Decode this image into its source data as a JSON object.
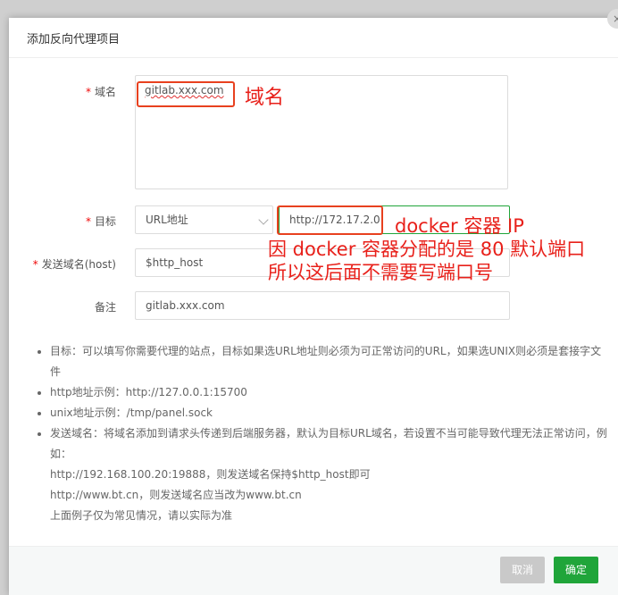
{
  "dialog": {
    "title": "添加反向代理项目",
    "close_symbol": "×"
  },
  "form": {
    "domain_label": "域名",
    "domain_value": "gitlab.xxx.com",
    "target_label": "目标",
    "target_type": "URL地址",
    "target_url": "http://172.17.2.0",
    "host_label": "发送域名(host)",
    "host_value": "$http_host",
    "remark_label": "备注",
    "remark_value": "gitlab.xxx.com",
    "required_mark": "*"
  },
  "notes": {
    "item1": "目标：可以填写你需要代理的站点，目标如果选URL地址则必须为可正常访问的URL，如果选UNIX则必须是套接字文件",
    "item2": "http地址示例：http://127.0.0.1:15700",
    "item3": "unix地址示例：/tmp/panel.sock",
    "item4": "发送域名：将域名添加到请求头传递到后端服务器，默认为目标URL域名，若设置不当可能导致代理无法正常访问，例如：",
    "item4_line2": "http://192.168.100.20:19888，则发送域名保持$http_host即可",
    "item4_line3": "http://www.bt.cn，则发送域名应当改为www.bt.cn",
    "item4_line4": "上面例子仅为常见情况，请以实际为准"
  },
  "footer": {
    "cancel_label": "取消",
    "confirm_label": "确定"
  },
  "annotations": {
    "domain_note": "域名",
    "docker_ip_note": "docker 容器 IP",
    "port_note_line1": "因 docker 容器分配的是 80 默认端口",
    "port_note_line2": "所以这后面不需要写端口号"
  },
  "colors": {
    "primary": "#20a53a",
    "annotation": "#e8201a",
    "required": "#ef0808"
  }
}
